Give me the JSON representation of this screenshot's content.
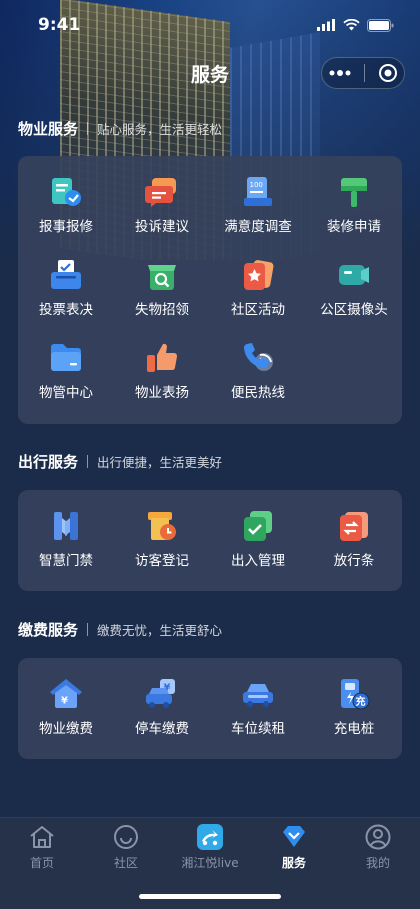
{
  "status_bar": {
    "time": "9:41"
  },
  "nav": {
    "title": "服务"
  },
  "sections": [
    {
      "title": "物业服务",
      "subtitle": "贴心服务，生活更轻松",
      "items": [
        {
          "label": "报事报修",
          "icon": "repair-report-icon"
        },
        {
          "label": "投诉建议",
          "icon": "complaint-chat-icon"
        },
        {
          "label": "满意度调查",
          "icon": "survey-icon"
        },
        {
          "label": "装修申请",
          "icon": "paint-roller-icon"
        },
        {
          "label": "投票表决",
          "icon": "vote-box-icon"
        },
        {
          "label": "失物招领",
          "icon": "lost-found-icon"
        },
        {
          "label": "社区活动",
          "icon": "community-star-icon"
        },
        {
          "label": "公区摄像头",
          "icon": "camera-icon"
        },
        {
          "label": "物管中心",
          "icon": "folder-icon"
        },
        {
          "label": "物业表扬",
          "icon": "thumbs-up-icon"
        },
        {
          "label": "便民热线",
          "icon": "phone-icon"
        }
      ]
    },
    {
      "title": "出行服务",
      "subtitle": "出行便捷，生活更美好",
      "items": [
        {
          "label": "智慧门禁",
          "icon": "gate-icon"
        },
        {
          "label": "访客登记",
          "icon": "visitor-icon"
        },
        {
          "label": "出入管理",
          "icon": "access-check-icon"
        },
        {
          "label": "放行条",
          "icon": "release-pass-icon"
        }
      ]
    },
    {
      "title": "缴费服务",
      "subtitle": "缴费无忧，生活更舒心",
      "items": [
        {
          "label": "物业缴费",
          "icon": "house-yuan-icon"
        },
        {
          "label": "停车缴费",
          "icon": "car-yuan-icon"
        },
        {
          "label": "车位续租",
          "icon": "car-icon"
        },
        {
          "label": "充电桩",
          "icon": "charger-icon",
          "badge": "充"
        }
      ]
    }
  ],
  "tabbar": [
    {
      "label": "首页",
      "icon": "home-icon"
    },
    {
      "label": "社区",
      "icon": "smile-icon"
    },
    {
      "label": "湘江悦live",
      "icon": "live-logo-icon"
    },
    {
      "label": "服务",
      "icon": "service-diamond-icon",
      "active": true
    },
    {
      "label": "我的",
      "icon": "profile-icon"
    }
  ]
}
